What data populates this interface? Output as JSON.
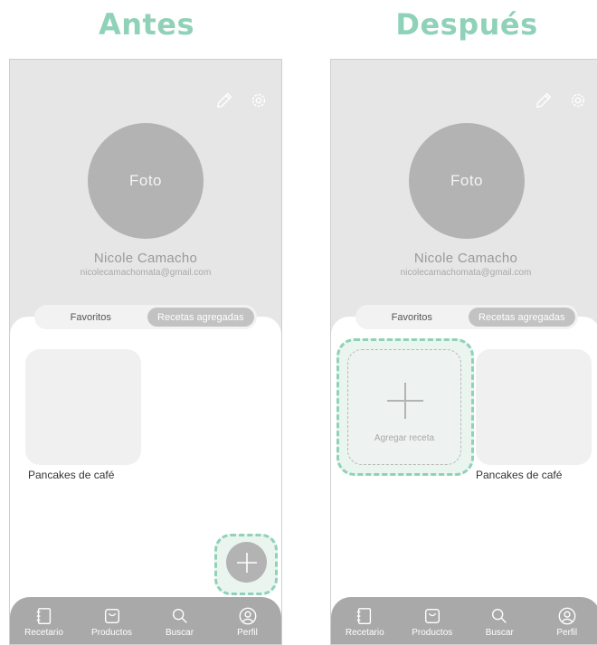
{
  "titles": {
    "before": "Antes",
    "after": "Después"
  },
  "profile": {
    "photo_label": "Foto",
    "name": "Nicole Camacho",
    "email": "nicolecamachomata@gmail.com"
  },
  "tabs": {
    "favorites": "Favoritos",
    "added": "Recetas agregadas"
  },
  "recipes": [
    {
      "name": "Pancakes de café"
    }
  ],
  "add_recipe_label": "Agregar receta",
  "nav": [
    {
      "label": "Recetario",
      "icon": "book-icon"
    },
    {
      "label": "Productos",
      "icon": "bag-icon"
    },
    {
      "label": "Buscar",
      "icon": "search-icon"
    },
    {
      "label": "Perfil",
      "icon": "profile-icon"
    }
  ],
  "colors": {
    "highlight": "#8fd1b9",
    "panel_bg": "#e6e6e6",
    "nav_bg": "#a9a9a9",
    "avatar_bg": "#b3b3b3"
  }
}
